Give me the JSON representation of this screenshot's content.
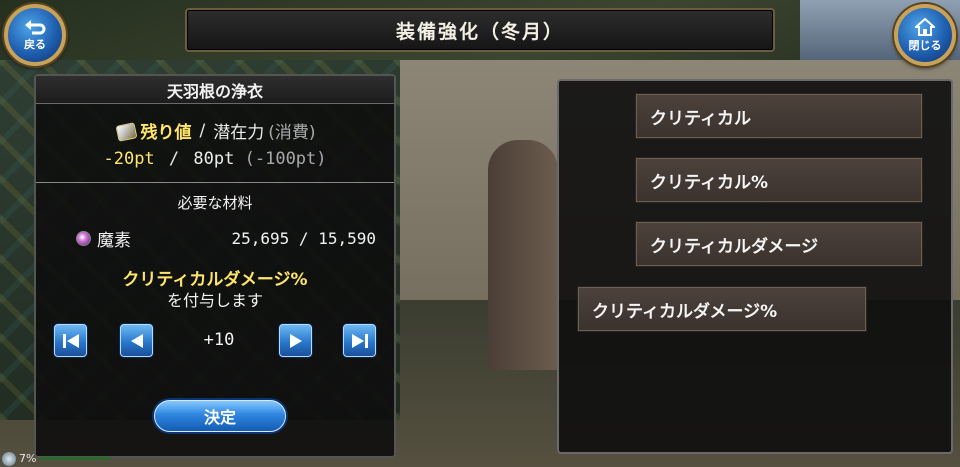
{
  "header": {
    "title": "装備強化（冬月）",
    "back_label": "戻る",
    "close_label": "閉じる"
  },
  "left_panel": {
    "item_name": "天羽根の浄衣",
    "remaining_label": "残り値",
    "potential_label": "潜在力",
    "consume_label": "(消費)",
    "remaining_value": "-20pt",
    "potential_value": "80pt",
    "consume_value": "(-100pt)",
    "materials_title": "必要な材料",
    "material": {
      "name": "魔素",
      "quantity": "25,695 / 15,590",
      "icon": "orb-icon"
    },
    "grant_option": "クリティカルダメージ%",
    "grant_suffix": "を付与します",
    "step_value": "+10",
    "decide_label": "決定"
  },
  "right_panel": {
    "options": [
      {
        "label": "クリティカル"
      },
      {
        "label": "クリティカル%"
      },
      {
        "label": "クリティカルダメージ"
      },
      {
        "label": "クリティカルダメージ%"
      }
    ]
  },
  "status": {
    "percent_text": "7%"
  },
  "colors": {
    "highlight_yellow": "#ffe66a",
    "button_blue": "#2a78cc",
    "option_brown": "#4d423c"
  }
}
